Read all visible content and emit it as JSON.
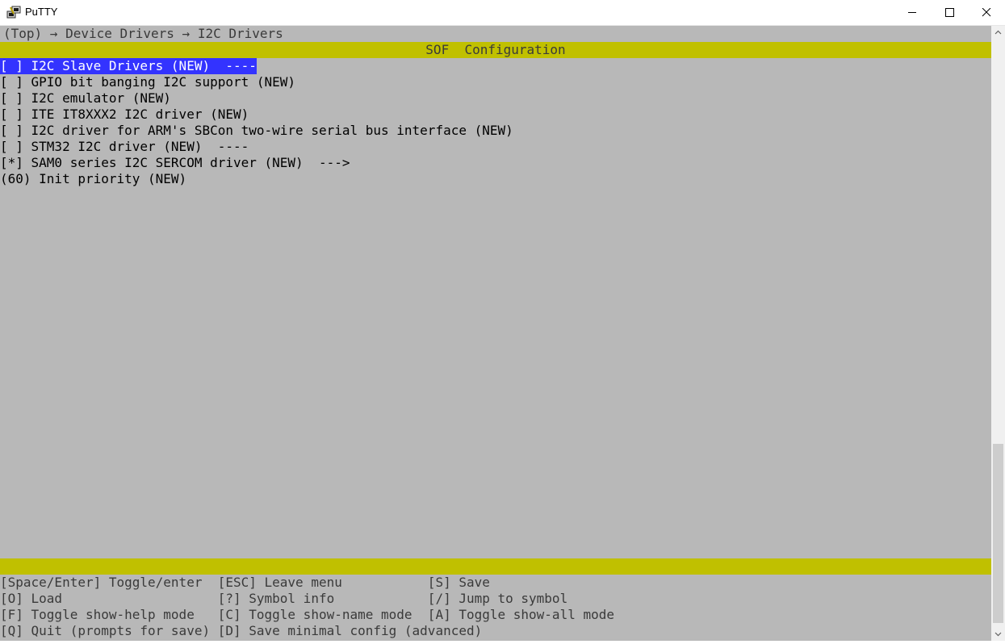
{
  "window": {
    "title": "PuTTY"
  },
  "breadcrumb": {
    "text": "(Top) → Device Drivers → I2C Drivers"
  },
  "header": {
    "title": "SOF  Configuration"
  },
  "menu": {
    "items": [
      {
        "text": "[ ] I2C Slave Drivers (NEW)  ----",
        "selected": true
      },
      {
        "text": "[ ] GPIO bit banging I2C support (NEW)"
      },
      {
        "text": "[ ] I2C emulator (NEW)"
      },
      {
        "text": "[ ] ITE IT8XXX2 I2C driver (NEW)"
      },
      {
        "text": "[ ] I2C driver for ARM's SBCon two-wire serial bus interface (NEW)"
      },
      {
        "text": "[ ] STM32 I2C driver (NEW)  ----"
      },
      {
        "text": "[*] SAM0 series I2C SERCOM driver (NEW)  --->"
      },
      {
        "text": "(60) Init priority (NEW)"
      }
    ]
  },
  "help": {
    "lines": [
      "[Space/Enter] Toggle/enter  [ESC] Leave menu           [S] Save",
      "[O] Load                    [?] Symbol info            [/] Jump to symbol",
      "[F] Toggle show-help mode   [C] Toggle show-name mode  [A] Toggle show-all mode",
      "[Q] Quit (prompts for save) [D] Save minimal config (advanced)"
    ]
  },
  "colors": {
    "terminal_bg": "#b8b8b8",
    "bar": "#c0c000",
    "selection": "#3333ff"
  },
  "icons": {
    "app": "putty-icon",
    "minimize": "minimize-icon",
    "maximize": "maximize-icon",
    "close": "close-icon"
  }
}
